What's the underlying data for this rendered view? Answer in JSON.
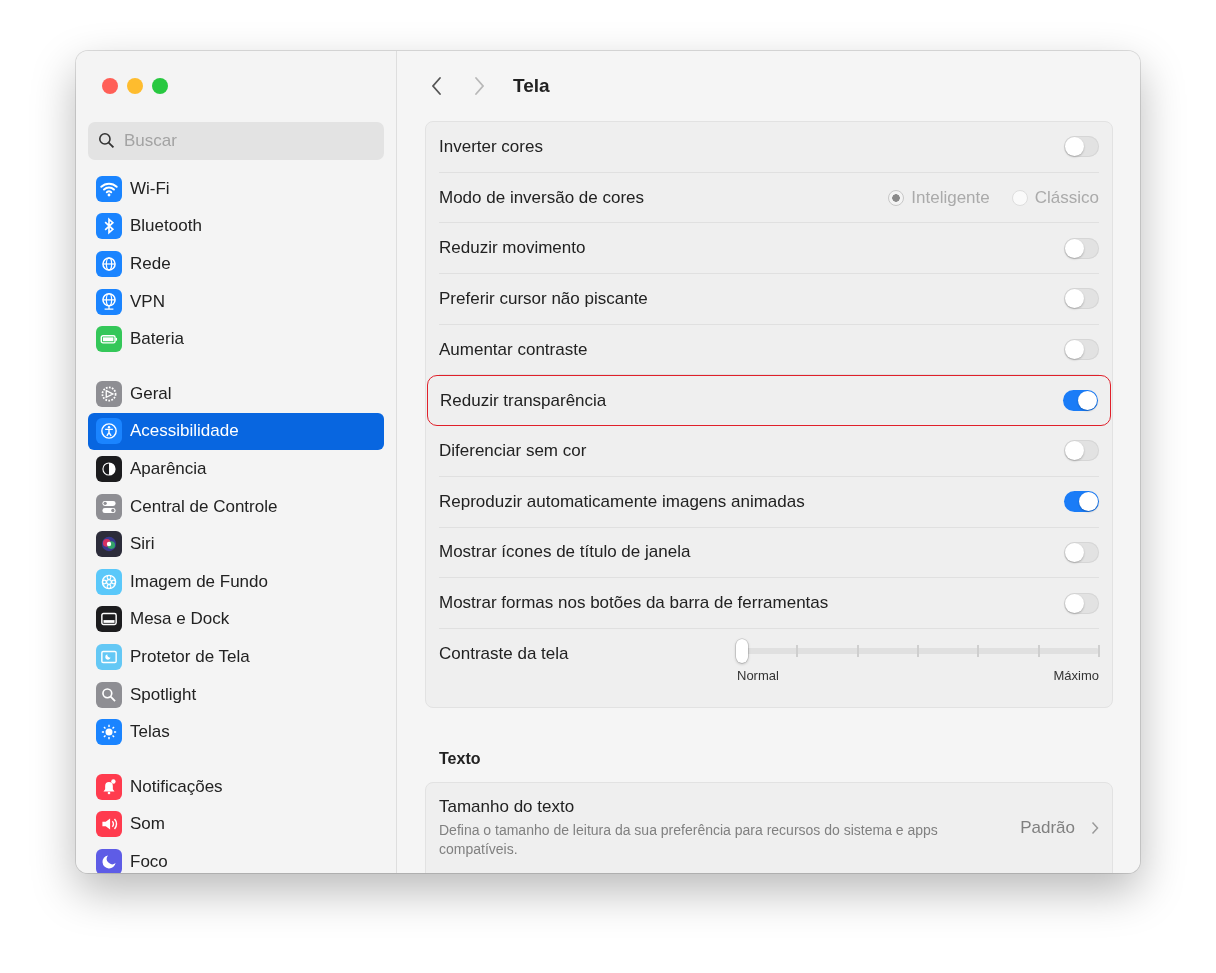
{
  "window": {
    "traffic_lights": [
      {
        "color": "#ff5f57"
      },
      {
        "color": "#febc2e"
      },
      {
        "color": "#28c840"
      }
    ]
  },
  "search": {
    "placeholder": "Buscar"
  },
  "sidebar": {
    "groups": [
      [
        {
          "label": "Wi-Fi",
          "color": "#1a84ff",
          "selected": false
        },
        {
          "label": "Bluetooth",
          "color": "#1a84ff",
          "selected": false
        },
        {
          "label": "Rede",
          "color": "#1a84ff",
          "selected": false
        },
        {
          "label": "VPN",
          "color": "#1a84ff",
          "selected": false
        },
        {
          "label": "Bateria",
          "color": "#34c759",
          "selected": false
        }
      ],
      [
        {
          "label": "Geral",
          "color": "#8e8e93",
          "selected": false
        },
        {
          "label": "Acessibilidade",
          "color": "#1a84ff",
          "selected": true
        },
        {
          "label": "Aparência",
          "color": "#1c1c1e",
          "selected": false
        },
        {
          "label": "Central de Controle",
          "color": "#8e8e93",
          "selected": false
        },
        {
          "label": "Siri",
          "color": "#2c2c3a",
          "selected": false
        },
        {
          "label": "Imagem de Fundo",
          "color": "#5ac8fa",
          "selected": false
        },
        {
          "label": "Mesa e Dock",
          "color": "#1c1c1e",
          "selected": false
        },
        {
          "label": "Protetor de Tela",
          "color": "#64c8f5",
          "selected": false
        },
        {
          "label": "Spotlight",
          "color": "#8e8e93",
          "selected": false
        },
        {
          "label": "Telas",
          "color": "#1a84ff",
          "selected": false
        }
      ],
      [
        {
          "label": "Notificações",
          "color": "#ff3b4e",
          "selected": false
        },
        {
          "label": "Som",
          "color": "#ff3b4e",
          "selected": false
        },
        {
          "label": "Foco",
          "color": "#5e5ce6",
          "selected": false
        }
      ]
    ]
  },
  "nav": [
    {
      "kind": "back",
      "disabled": false
    },
    {
      "kind": "forward",
      "disabled": true
    }
  ],
  "title": "Tela",
  "display_rows": [
    {
      "kind": "toggle",
      "label": "Inverter cores",
      "on": false,
      "highlighted": false
    },
    {
      "kind": "radio",
      "label": "Modo de inversão de cores",
      "disabled": true,
      "highlighted": false,
      "options": [
        {
          "label": "Inteligente",
          "selected": true
        },
        {
          "label": "Clássico",
          "selected": false
        }
      ]
    },
    {
      "kind": "toggle",
      "label": "Reduzir movimento",
      "on": false,
      "highlighted": false
    },
    {
      "kind": "toggle",
      "label": "Preferir cursor não piscante",
      "on": false,
      "highlighted": false
    },
    {
      "kind": "toggle",
      "label": "Aumentar contraste",
      "on": false,
      "highlighted": false
    },
    {
      "kind": "toggle",
      "label": "Reduzir transparência",
      "on": true,
      "highlighted": true
    },
    {
      "kind": "toggle",
      "label": "Diferenciar sem cor",
      "on": false,
      "highlighted": false
    },
    {
      "kind": "toggle",
      "label": "Reproduzir automaticamente imagens animadas",
      "on": true,
      "highlighted": false
    },
    {
      "kind": "toggle",
      "label": "Mostrar ícones de título de janela",
      "on": false,
      "highlighted": false
    },
    {
      "kind": "toggle",
      "label": "Mostrar formas nos botões da barra de ferramentas",
      "on": false,
      "highlighted": false
    },
    {
      "kind": "slider",
      "label": "Contraste da tela",
      "level": 0,
      "min_label": "Normal",
      "max_label": "Máximo",
      "highlighted": false
    }
  ],
  "text_section": {
    "heading": "Texto",
    "rows": [
      {
        "title": "Tamanho do texto",
        "description": "Defina o tamanho de leitura da sua preferência para recursos do sistema e apps compatíveis.",
        "value": "Padrão"
      }
    ]
  }
}
